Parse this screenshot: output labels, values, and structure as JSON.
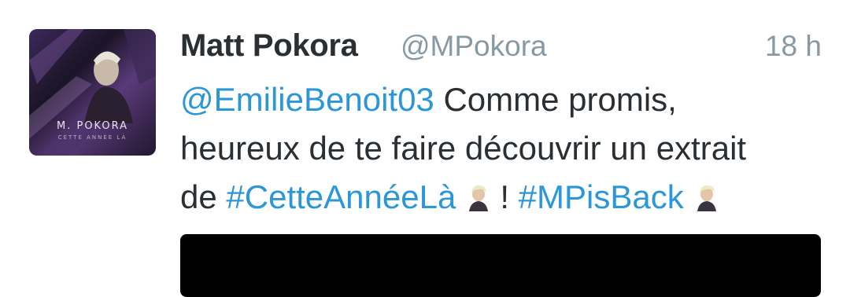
{
  "tweet": {
    "author_name": "Matt Pokora",
    "author_handle": "@MPokora",
    "timestamp": "18 h",
    "avatar": {
      "cover_title": "M. POKORA",
      "cover_subtitle": "CETTE ANNÉE LÀ"
    },
    "text": {
      "mention": "@EmilieBenoit03",
      "part1": " Comme promis,",
      "part2": "heureux de te faire découvrir un extrait",
      "part3": "de ",
      "hashtag1": "#CetteAnnéeLà",
      "part4": "! ",
      "hashtag2": "#MPisBack"
    },
    "emoji_name": "person-blond-hair-emoji"
  },
  "colors": {
    "link": "#2b96d8",
    "name_text": "#292f33",
    "secondary_text": "#8899a6"
  }
}
